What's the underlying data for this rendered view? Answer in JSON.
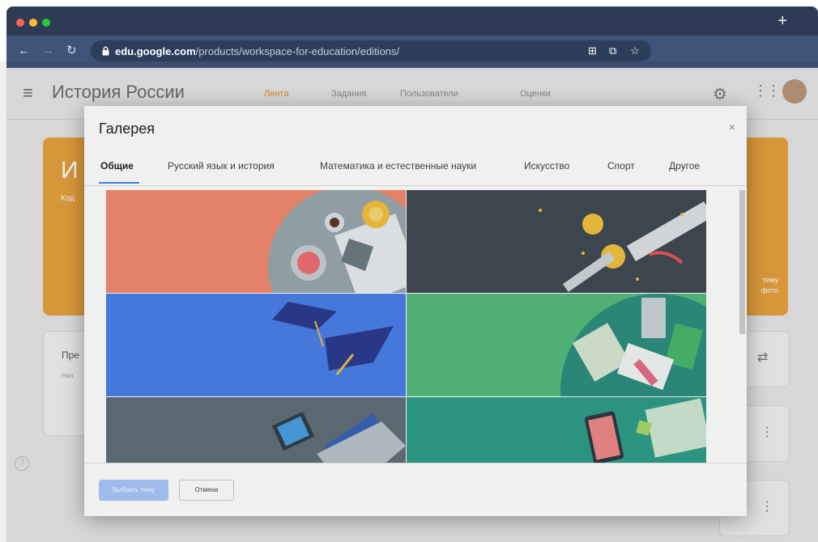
{
  "browser": {
    "url_host": "edu.google.com",
    "url_path": "/products/workspace-for-education/editions/",
    "newtab_label": "+"
  },
  "app": {
    "course_title": "История России",
    "tabs": [
      {
        "label": "Лента",
        "active": true
      },
      {
        "label": "Задания",
        "active": false
      },
      {
        "label": "Пользователи",
        "active": false
      },
      {
        "label": "Оценки",
        "active": false
      }
    ],
    "banner_title_visible": "И",
    "banner_code_visible": "Код",
    "banner_side_text": [
      "тему",
      "фото"
    ],
    "card_title_visible": "Пре",
    "card_sub_visible": "Нап"
  },
  "dialog": {
    "title": "Галерея",
    "close_icon": "close-icon",
    "tabs": [
      {
        "label": "Общие",
        "active": true
      },
      {
        "label": "Русский язык и история",
        "active": false
      },
      {
        "label": "Математика и естественные науки",
        "active": false
      },
      {
        "label": "Искусство",
        "active": false
      },
      {
        "label": "Спорт",
        "active": false
      },
      {
        "label": "Другое",
        "active": false
      }
    ],
    "themes": [
      {
        "theme": "coffee-and-newspaper",
        "bg": "#f28b6f"
      },
      {
        "theme": "diploma-and-coins",
        "bg": "#414b54"
      },
      {
        "theme": "graduation-caps",
        "bg": "#4a80e8"
      },
      {
        "theme": "books-on-table",
        "bg": "#57bb7e"
      },
      {
        "theme": "laptop-and-tablet",
        "bg": "#5f6f79"
      },
      {
        "theme": "phone-and-notes",
        "bg": "#2e9e8a"
      }
    ],
    "select_button": "Выбрать тему",
    "cancel_button": "Отмена"
  },
  "colors": {
    "titlebar": "#2d3b55",
    "addressbar": "#3e5478",
    "banner": "#e6a03e",
    "accent": "#4285f4"
  }
}
